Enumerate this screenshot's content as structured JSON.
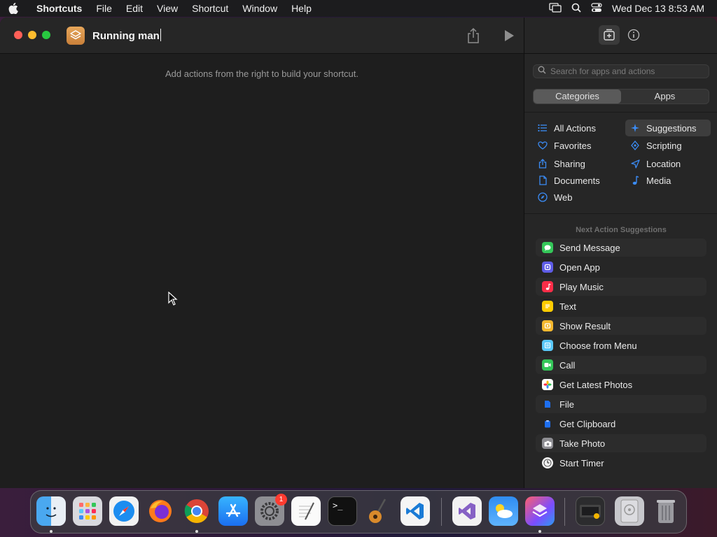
{
  "menubar": {
    "app_name": "Shortcuts",
    "items": [
      "File",
      "Edit",
      "View",
      "Shortcut",
      "Window",
      "Help"
    ],
    "clock": "Wed Dec 13  8:53 AM"
  },
  "editor": {
    "shortcut_name": "Running man",
    "hint": "Add actions from the right to build your shortcut."
  },
  "sidebar": {
    "search_placeholder": "Search for apps and actions",
    "segments": [
      "Categories",
      "Apps"
    ],
    "active_segment": "Categories",
    "categories": [
      {
        "label": "All Actions",
        "icon": "list-icon"
      },
      {
        "label": "Suggestions",
        "icon": "sparkle-icon",
        "selected": true
      },
      {
        "label": "Favorites",
        "icon": "heart-icon"
      },
      {
        "label": "Scripting",
        "icon": "scripting-icon"
      },
      {
        "label": "Sharing",
        "icon": "share-icon"
      },
      {
        "label": "Location",
        "icon": "location-arrow-icon"
      },
      {
        "label": "Documents",
        "icon": "document-icon"
      },
      {
        "label": "Media",
        "icon": "music-note-icon"
      },
      {
        "label": "Web",
        "icon": "compass-icon"
      }
    ],
    "suggestions_title": "Next Action Suggestions",
    "suggestions": [
      {
        "label": "Send Message",
        "icon": "messages-icon",
        "color": "#34c759"
      },
      {
        "label": "Open App",
        "icon": "open-app-icon",
        "color": "#5e5ce6"
      },
      {
        "label": "Play Music",
        "icon": "music-icon",
        "color": "#fa2d48"
      },
      {
        "label": "Text",
        "icon": "text-icon",
        "color": "#ffcc00"
      },
      {
        "label": "Show Result",
        "icon": "show-result-icon",
        "color": "#f5b82e"
      },
      {
        "label": "Choose from Menu",
        "icon": "menu-icon",
        "color": "#5ac8fa"
      },
      {
        "label": "Call",
        "icon": "facetime-icon",
        "color": "#34c759"
      },
      {
        "label": "Get Latest Photos",
        "icon": "photos-icon",
        "color": "#ffffff"
      },
      {
        "label": "File",
        "icon": "file-icon",
        "color": "#1e6ff0"
      },
      {
        "label": "Get Clipboard",
        "icon": "clipboard-icon",
        "color": "#1e6ff0"
      },
      {
        "label": "Take Photo",
        "icon": "camera-icon",
        "color": "#8e8e93"
      },
      {
        "label": "Start Timer",
        "icon": "clock-icon",
        "color": "#f2f2f2"
      }
    ]
  },
  "dock": {
    "apps": [
      {
        "name": "Finder",
        "icon": "finder-icon"
      },
      {
        "name": "Launchpad",
        "icon": "launchpad-icon"
      },
      {
        "name": "Safari",
        "icon": "safari-icon"
      },
      {
        "name": "Firefox",
        "icon": "firefox-icon"
      },
      {
        "name": "Chrome",
        "icon": "chrome-icon"
      },
      {
        "name": "App Store",
        "icon": "app-store-icon"
      },
      {
        "name": "System Settings",
        "icon": "settings-icon",
        "badge": "1"
      },
      {
        "name": "TextEdit",
        "icon": "textedit-icon"
      },
      {
        "name": "Terminal",
        "icon": "terminal-icon"
      },
      {
        "name": "GarageBand",
        "icon": "guitar-icon"
      },
      {
        "name": "VS Code",
        "icon": "vscode-icon"
      },
      {
        "name": "Visual Studio",
        "icon": "visual-studio-icon"
      },
      {
        "name": "Weather",
        "icon": "weather-icon"
      },
      {
        "name": "Shortcuts",
        "icon": "shortcuts-icon"
      },
      {
        "name": "Downloads",
        "icon": "downloads-folder-icon"
      },
      {
        "name": "Disk",
        "icon": "disk-icon"
      },
      {
        "name": "Trash",
        "icon": "trash-icon"
      }
    ]
  }
}
